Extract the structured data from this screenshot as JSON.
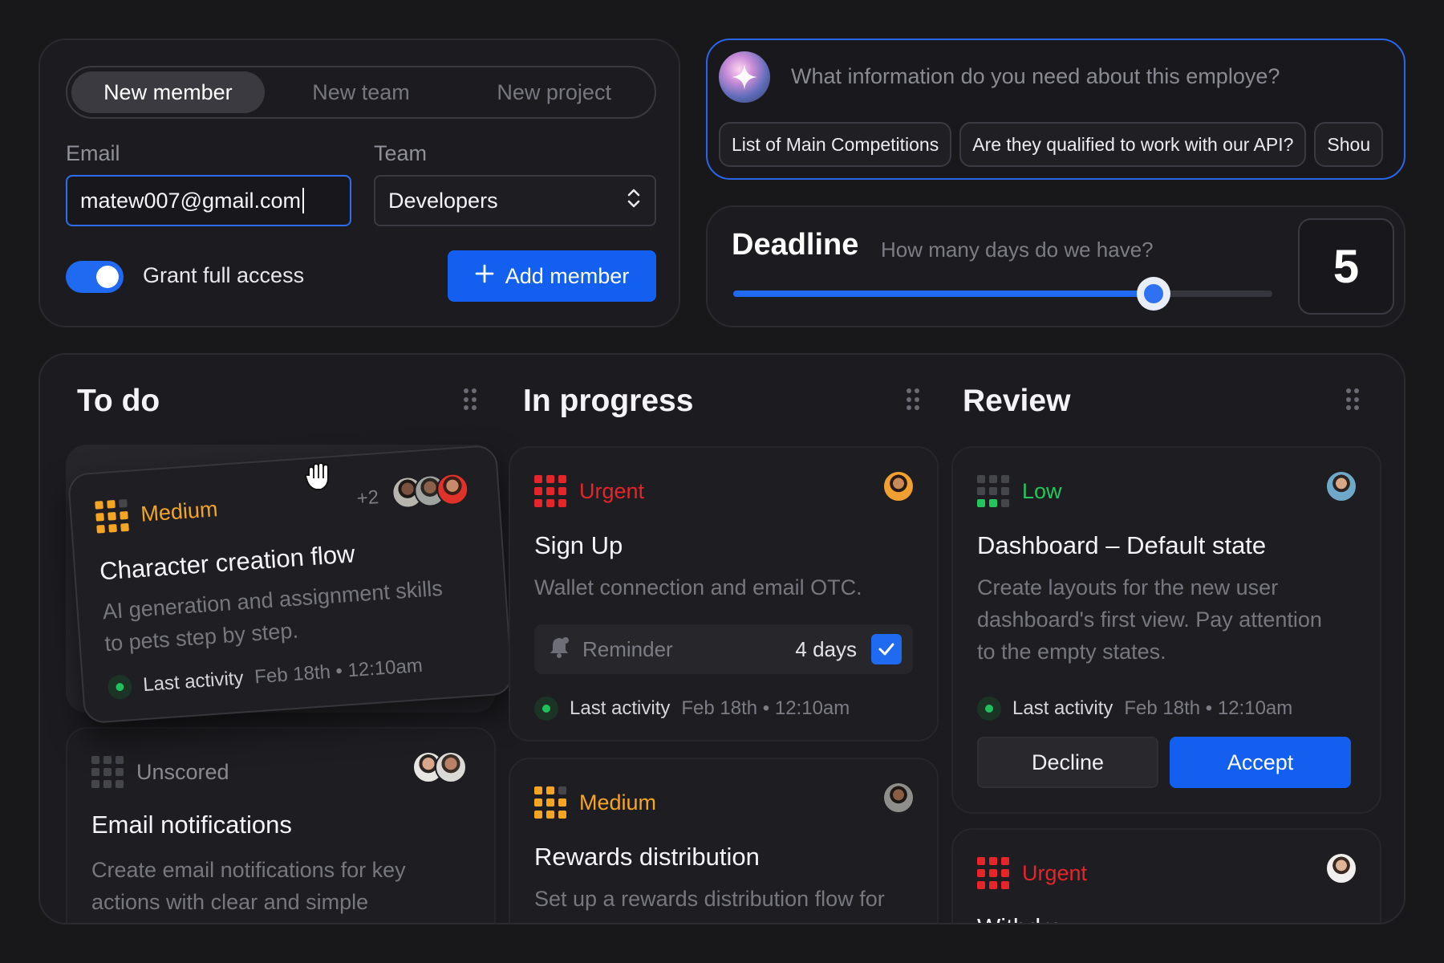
{
  "colors": {
    "accent": "#1360f0",
    "medium": "#f5a524",
    "urgent": "#e5252a",
    "low": "#22c55e",
    "unscored": "#55555c"
  },
  "member_form": {
    "tabs": [
      {
        "label": "New member"
      },
      {
        "label": "New team"
      },
      {
        "label": "New project"
      }
    ],
    "email_label": "Email",
    "email_value": "matew007@gmail.com",
    "team_label": "Team",
    "team_value": "Developers",
    "toggle_on": true,
    "access_label": "Grant full access",
    "add_button": "Add member"
  },
  "ai_search": {
    "placeholder": "What information do you need about this employe?",
    "chips": [
      "List of Main Competitions",
      "Are they qualified to work with our API?",
      "Shou"
    ]
  },
  "deadline": {
    "title": "Deadline",
    "subtitle": "How many days do we have?",
    "slider_fraction": 0.78,
    "value": "5"
  },
  "board": {
    "columns": [
      {
        "title": "To do"
      },
      {
        "title": "In progress"
      },
      {
        "title": "Review"
      }
    ],
    "cards": {
      "character": {
        "priority": "Medium",
        "title": "Character creation flow",
        "desc_1": "AI generation and assignment skills",
        "desc_2": "to pets step by step.",
        "more": "+2",
        "activity_label": "Last activity",
        "activity_time": "Feb 18th • 12:10am"
      },
      "email": {
        "priority": "Unscored",
        "title": "Email notifications",
        "desc_1": "Create email notifications for key",
        "desc_2": "actions with clear and simple"
      },
      "signup": {
        "priority": "Urgent",
        "title": "Sign Up",
        "desc_1": "Wallet connection and email OTC.",
        "reminder_label": "Reminder",
        "reminder_days": "4 days",
        "reminder_checked": true,
        "activity_label": "Last activity",
        "activity_time": "Feb 18th • 12:10am"
      },
      "rewards": {
        "priority": "Medium",
        "title": "Rewards distribution",
        "desc_1": "Set up a rewards distribution flow for"
      },
      "dashboard": {
        "priority": "Low",
        "title": "Dashboard – Default state",
        "desc_1": "Create layouts for the new user",
        "desc_2": "dashboard's first view. Pay attention",
        "desc_3": "to the empty states.",
        "activity_label": "Last activity",
        "activity_time": "Feb 18th • 12:10am",
        "decline": "Decline",
        "accept": "Accept"
      },
      "withdraw": {
        "priority": "Urgent",
        "title": "Withdraw"
      }
    }
  }
}
